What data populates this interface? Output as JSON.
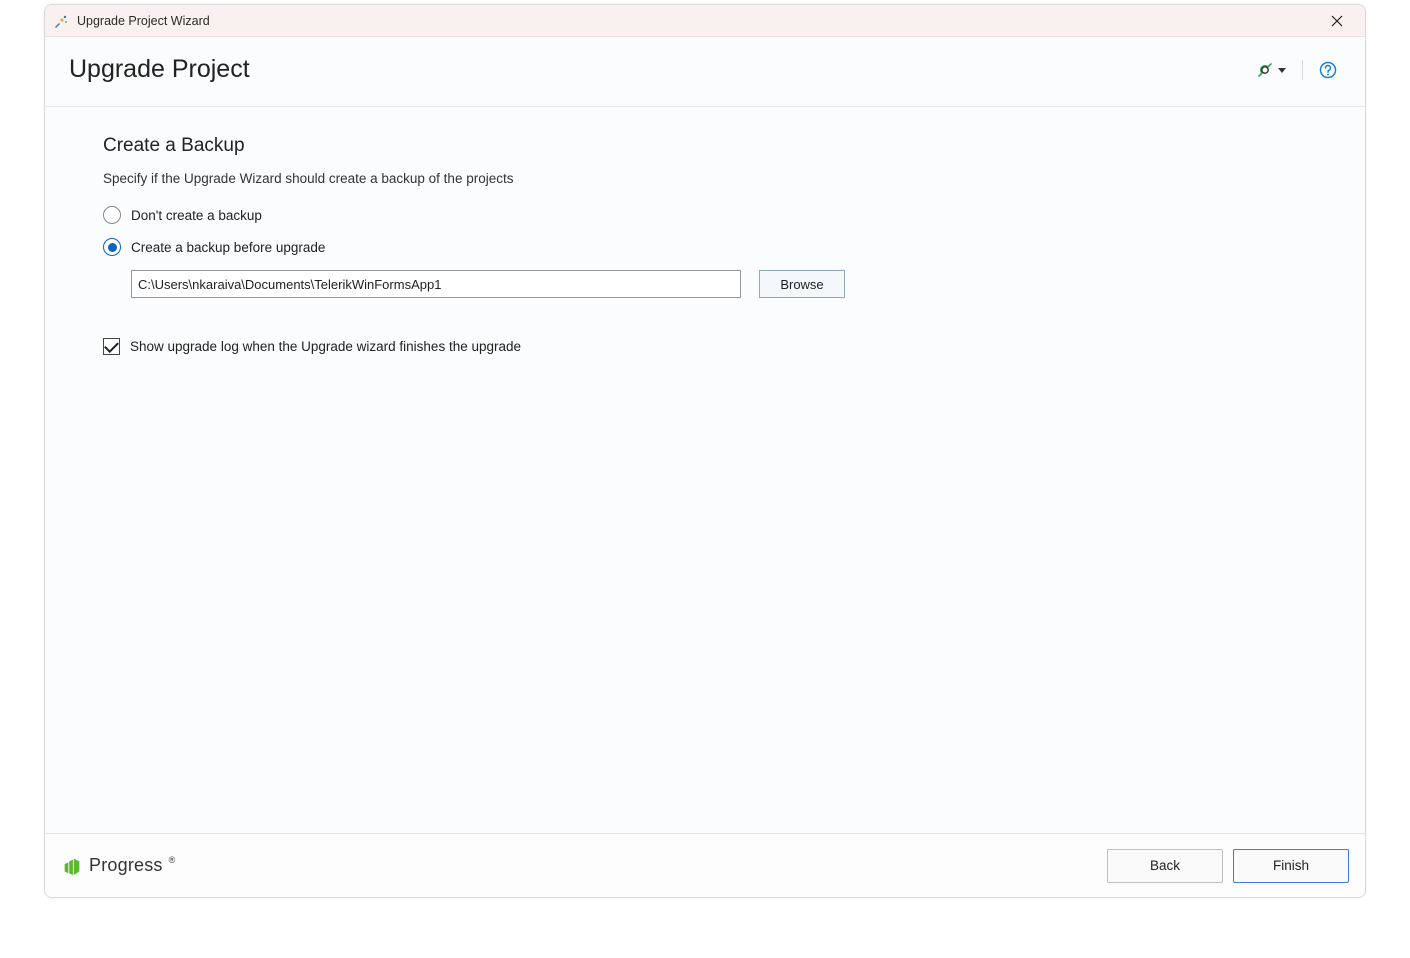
{
  "window": {
    "title": "Upgrade Project Wizard"
  },
  "header": {
    "title": "Upgrade Project"
  },
  "section": {
    "title": "Create a Backup",
    "description": "Specify if the Upgrade Wizard should create a backup of the projects"
  },
  "options": {
    "no_backup": {
      "label": "Don't create a backup",
      "checked": false
    },
    "create_backup": {
      "label": "Create a backup before upgrade",
      "checked": true
    },
    "backup_path": "C:\\Users\\nkaraiva\\Documents\\TelerikWinFormsApp1",
    "browse_label": "Browse",
    "show_log": {
      "label": "Show upgrade log when the Upgrade wizard finishes the upgrade",
      "checked": true
    }
  },
  "footer": {
    "logo": "Progress",
    "back_label": "Back",
    "finish_label": "Finish"
  },
  "icons": {
    "app": "wizard-icon",
    "close": "close-icon",
    "settings": "settings-pen-icon",
    "dropdown": "chevron-down-icon",
    "help": "help-icon"
  }
}
